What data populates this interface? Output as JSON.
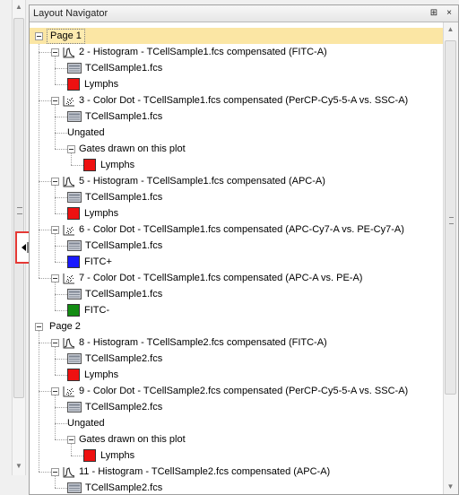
{
  "panel": {
    "title": "Layout Navigator",
    "pin_glyph": "⊞",
    "close_glyph": "×"
  },
  "colors": {
    "red": "#ee1111",
    "blue": "#1a1aff",
    "green": "#138c13",
    "selection": "#fbe6a4"
  },
  "tree": [
    {
      "type": "page",
      "label": "Page 1",
      "selected": true,
      "depth": 0
    },
    {
      "type": "plot",
      "plot": "histogram",
      "label": "2 - Histogram - TCellSample1.fcs compensated (FITC-A)",
      "depth": 1
    },
    {
      "type": "sample",
      "label": "TCellSample1.fcs",
      "depth": 2
    },
    {
      "type": "gate",
      "label": "Lymphs",
      "color": "red",
      "depth": 2
    },
    {
      "type": "plot",
      "plot": "dot",
      "label": "3 - Color Dot - TCellSample1.fcs compensated (PerCP-Cy5-5-A vs. SSC-A)",
      "depth": 1
    },
    {
      "type": "sample",
      "label": "TCellSample1.fcs",
      "depth": 2
    },
    {
      "type": "text",
      "label": "Ungated",
      "depth": 2
    },
    {
      "type": "group",
      "label": "Gates drawn on this plot",
      "depth": 2
    },
    {
      "type": "gate",
      "label": "Lymphs",
      "color": "red",
      "depth": 3
    },
    {
      "type": "plot",
      "plot": "histogram",
      "label": "5 - Histogram - TCellSample1.fcs compensated (APC-A)",
      "depth": 1
    },
    {
      "type": "sample",
      "label": "TCellSample1.fcs",
      "depth": 2
    },
    {
      "type": "gate",
      "label": "Lymphs",
      "color": "red",
      "depth": 2
    },
    {
      "type": "plot",
      "plot": "dot",
      "label": "6 - Color Dot - TCellSample1.fcs compensated (APC-Cy7-A vs. PE-Cy7-A)",
      "depth": 1
    },
    {
      "type": "sample",
      "label": "TCellSample1.fcs",
      "depth": 2
    },
    {
      "type": "gate",
      "label": "FITC+",
      "color": "blue",
      "depth": 2
    },
    {
      "type": "plot",
      "plot": "dot",
      "label": "7 - Color Dot - TCellSample1.fcs compensated (APC-A vs. PE-A)",
      "depth": 1
    },
    {
      "type": "sample",
      "label": "TCellSample1.fcs",
      "depth": 2
    },
    {
      "type": "gate",
      "label": "FITC-",
      "color": "green",
      "depth": 2
    },
    {
      "type": "page",
      "label": "Page 2",
      "selected": false,
      "depth": 0
    },
    {
      "type": "plot",
      "plot": "histogram",
      "label": "8 - Histogram - TCellSample2.fcs compensated (FITC-A)",
      "depth": 1
    },
    {
      "type": "sample",
      "label": "TCellSample2.fcs",
      "depth": 2
    },
    {
      "type": "gate",
      "label": "Lymphs",
      "color": "red",
      "depth": 2
    },
    {
      "type": "plot",
      "plot": "dot",
      "label": "9 - Color Dot - TCellSample2.fcs compensated (PerCP-Cy5-5-A vs. SSC-A)",
      "depth": 1
    },
    {
      "type": "sample",
      "label": "TCellSample2.fcs",
      "depth": 2
    },
    {
      "type": "text",
      "label": "Ungated",
      "depth": 2
    },
    {
      "type": "group",
      "label": "Gates drawn on this plot",
      "depth": 2
    },
    {
      "type": "gate",
      "label": "Lymphs",
      "color": "red",
      "depth": 3
    },
    {
      "type": "plot",
      "plot": "histogram",
      "label": "11 - Histogram - TCellSample2.fcs compensated (APC-A)",
      "depth": 1
    },
    {
      "type": "sample",
      "label": "TCellSample2.fcs",
      "depth": 2
    }
  ]
}
